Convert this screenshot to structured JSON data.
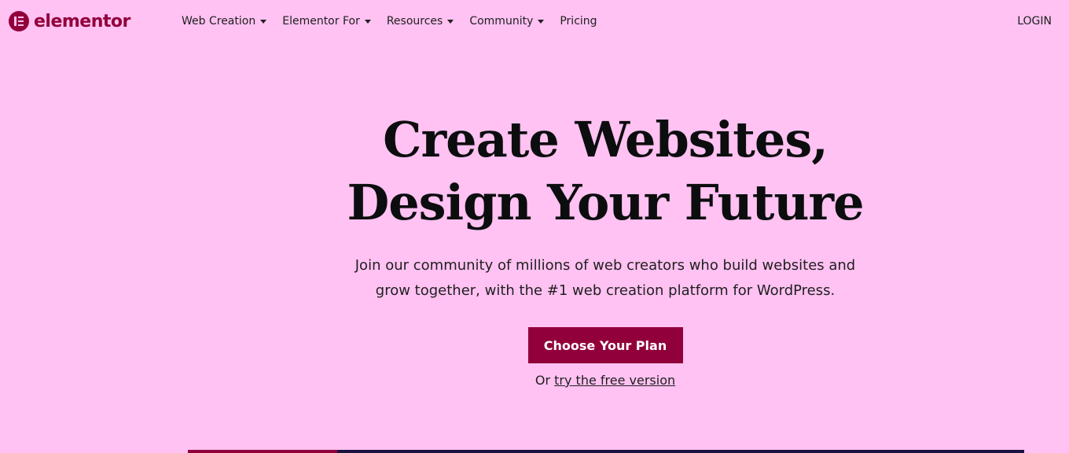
{
  "brand": {
    "name": "elementor",
    "color": "#92003b",
    "background": "#ffc2f2"
  },
  "nav": {
    "items": [
      {
        "label": "Web Creation",
        "dropdown": true
      },
      {
        "label": "Elementor For",
        "dropdown": true
      },
      {
        "label": "Resources",
        "dropdown": true
      },
      {
        "label": "Community",
        "dropdown": true
      },
      {
        "label": "Pricing",
        "dropdown": false
      }
    ],
    "login_label": "LOGIN"
  },
  "hero": {
    "title_line1": "Create Websites,",
    "title_line2": "Design Your Future",
    "subtitle": "Join our community of millions of web creators who build websites and grow together, with the #1 web creation platform for WordPress.",
    "cta_label": "Choose Your Plan",
    "alt_prefix": "Or",
    "alt_link": "try the free version"
  }
}
